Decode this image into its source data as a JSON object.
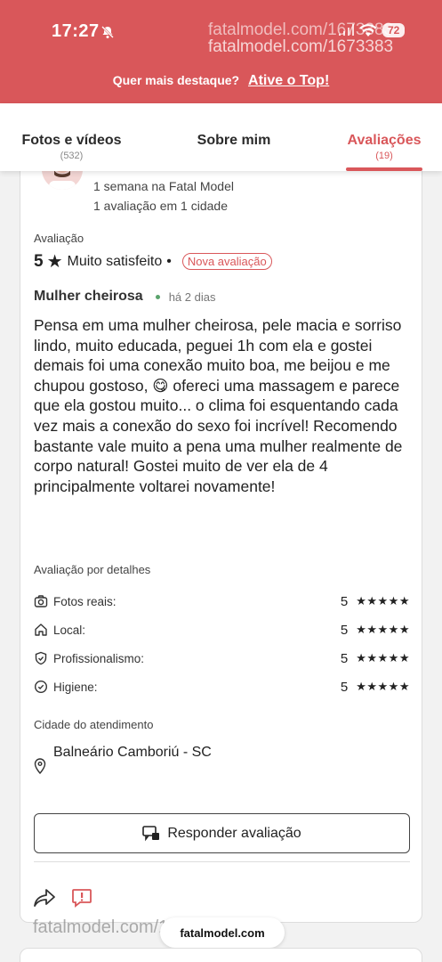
{
  "status_bar": {
    "time": "17:27",
    "battery": "72"
  },
  "watermark": {
    "line1": "fatalmodel.com/1673383",
    "line2": "fatalmodel.com/1673383",
    "bottom": "fatalmodel.com/1673383"
  },
  "promo": {
    "text": "Quer mais destaque?",
    "link": "Ative o Top!"
  },
  "tabs": [
    {
      "label": "Fotos e vídeos",
      "count": "(532)"
    },
    {
      "label": "Sobre mim",
      "count": ""
    },
    {
      "label": "Avaliações",
      "count": "(19)"
    }
  ],
  "reviewer": {
    "tenure": "1 semana na Fatal Model",
    "reviews": "1 avaliação em 1 cidade"
  },
  "review": {
    "section_label": "Avaliação",
    "score": "5",
    "star": "★",
    "verdict": "Muito satisfeito",
    "separator": "•",
    "badge": "Nova avaliação",
    "author": "Mulher cheirosa",
    "time_ago": "há 2 dias",
    "text": "Pensa em uma mulher cheirosa, pele macia e sorriso lindo, muito educada, peguei 1h com ela e gostei demais foi uma conexão muito boa, me beijou e me chupou gostoso, 😋 ofereci uma massagem e parece que ela gostou muito... o clima foi esquentando cada vez mais a conexão do sexo foi incrível! Recomendo bastante vale muito a pena uma mulher realmente de corpo natural! Gostei muito de ver ela de 4 principalmente voltarei novamente!"
  },
  "details": {
    "title": "Avaliação por detalhes",
    "items": [
      {
        "label": "Fotos reais:",
        "score": "5",
        "stars": "★★★★★",
        "icon": "camera-icon"
      },
      {
        "label": "Local:",
        "score": "5",
        "stars": "★★★★★",
        "icon": "home-icon"
      },
      {
        "label": "Profissionalismo:",
        "score": "5",
        "stars": "★★★★★",
        "icon": "shield-check-icon"
      },
      {
        "label": "Higiene:",
        "score": "5",
        "stars": "★★★★★",
        "icon": "check-circle-icon"
      }
    ]
  },
  "city": {
    "title": "Cidade do atendimento",
    "value": "Balneário Camboriú - SC"
  },
  "actions": {
    "reply": "Responder avaliação"
  },
  "browser": {
    "url": "fatalmodel.com"
  },
  "colors": {
    "brand": "#d9575a",
    "status_green": "#5aa36c"
  }
}
